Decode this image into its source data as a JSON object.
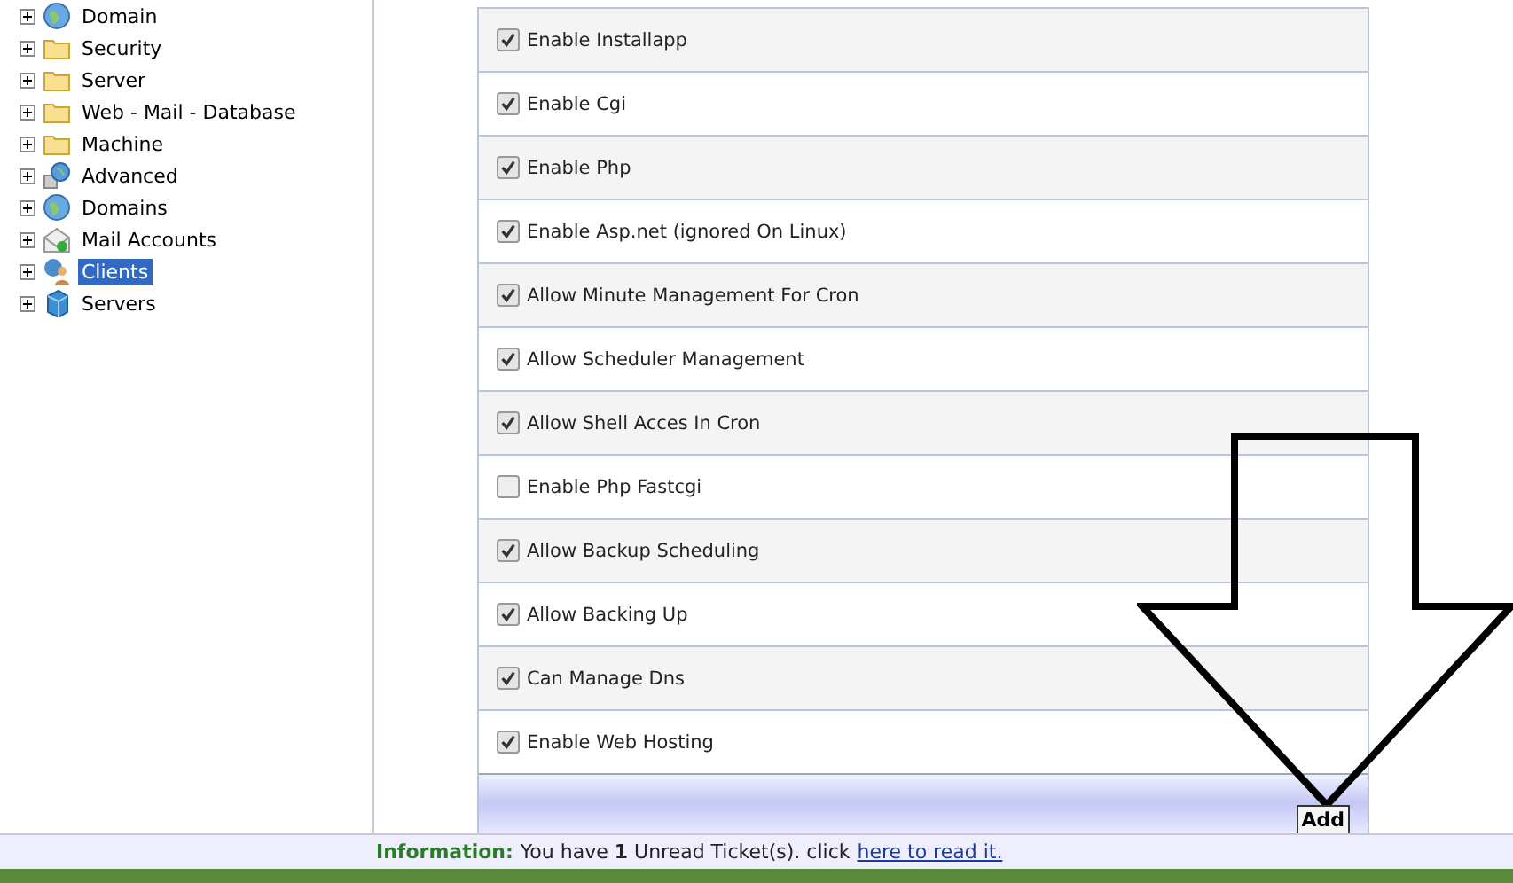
{
  "sidebar": {
    "items": [
      {
        "label": "Domain",
        "kind": "globe",
        "expanded": false,
        "selected": false
      },
      {
        "label": "Security",
        "kind": "folder",
        "expanded": false,
        "selected": false
      },
      {
        "label": "Server",
        "kind": "folder",
        "expanded": false,
        "selected": false
      },
      {
        "label": "Web - Mail - Database",
        "kind": "folder",
        "expanded": false,
        "selected": false
      },
      {
        "label": "Machine",
        "kind": "folder",
        "expanded": false,
        "selected": false
      },
      {
        "label": "Advanced",
        "kind": "network",
        "expanded": false,
        "selected": false
      },
      {
        "label": "Domains",
        "kind": "globe",
        "expanded": false,
        "selected": false
      },
      {
        "label": "Mail Accounts",
        "kind": "mail",
        "expanded": false,
        "selected": false
      },
      {
        "label": "Clients",
        "kind": "users",
        "expanded": false,
        "selected": true
      },
      {
        "label": "Servers",
        "kind": "box",
        "expanded": false,
        "selected": false
      }
    ]
  },
  "options": [
    {
      "label": "Enable Installapp",
      "checked": true
    },
    {
      "label": "Enable Cgi",
      "checked": true
    },
    {
      "label": "Enable Php",
      "checked": true
    },
    {
      "label": "Enable Asp.net (ignored On Linux)",
      "checked": true
    },
    {
      "label": "Allow Minute Management For Cron",
      "checked": true
    },
    {
      "label": "Allow Scheduler Management",
      "checked": true
    },
    {
      "label": "Allow Shell Acces In Cron",
      "checked": true
    },
    {
      "label": "Enable Php Fastcgi",
      "checked": false
    },
    {
      "label": "Allow Backup Scheduling",
      "checked": true
    },
    {
      "label": "Allow Backing Up",
      "checked": true
    },
    {
      "label": "Can Manage Dns",
      "checked": true
    },
    {
      "label": "Enable Web Hosting",
      "checked": true
    }
  ],
  "add_button": "Add",
  "info_bar": {
    "label": "Information:",
    "message": "You have **1** Unread Ticket(s). click",
    "link": "here to read it."
  }
}
